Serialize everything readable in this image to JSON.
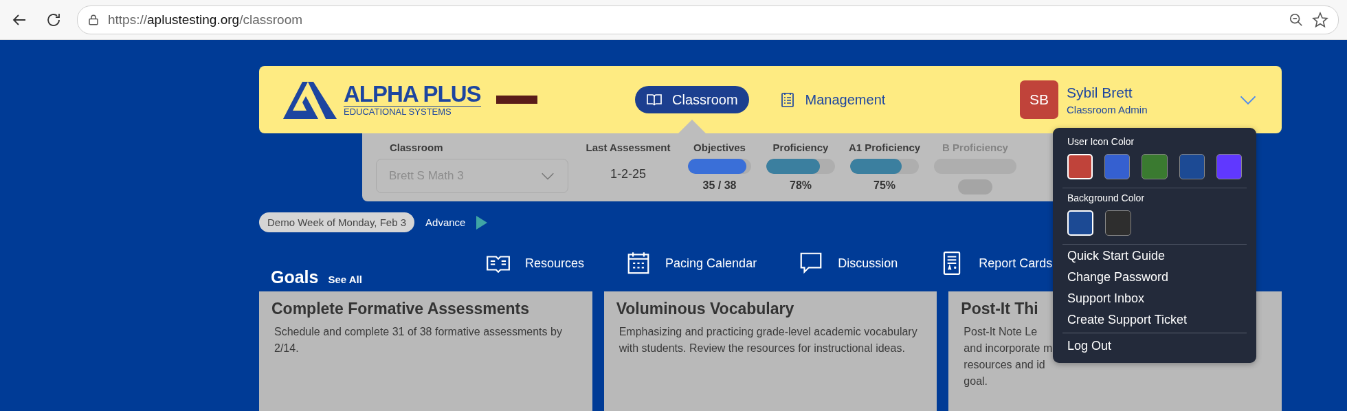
{
  "browser": {
    "url_scheme": "https://",
    "url_host": "aplustesting.org",
    "url_path": "/classroom"
  },
  "header": {
    "logo": {
      "title": "ALPHA PLUS",
      "subtitle": "EDUCATIONAL SYSTEMS"
    },
    "tabs": [
      {
        "label": "Classroom",
        "selected": true
      },
      {
        "label": "Management",
        "selected": false
      }
    ],
    "user": {
      "initials": "SB",
      "name": "Sybil Brett",
      "role": "Classroom Admin",
      "menu_expanded": true
    }
  },
  "stats": {
    "classroom": {
      "label": "Classroom",
      "value": "Brett S Math 3"
    },
    "last_assessment": {
      "label": "Last Assessment",
      "value": "1-2-25"
    },
    "metrics": [
      {
        "label": "Objectives",
        "level": 0.92,
        "reading": "35 / 38",
        "color": "#3a6fd8",
        "disabled": false
      },
      {
        "label": "Proficiency",
        "level": 0.78,
        "reading": "78%",
        "color": "#3b7f9f",
        "disabled": false
      },
      {
        "label": "A1 Proficiency",
        "level": 0.75,
        "reading": "75%",
        "color": "#3b7f9f",
        "disabled": false
      },
      {
        "label": "B Proficiency",
        "disabled": true
      }
    ]
  },
  "demo": {
    "week": "Demo Week of Monday, Feb 3",
    "advance": "Advance"
  },
  "goals": {
    "title": "Goals",
    "see_all": "See All"
  },
  "links": [
    {
      "label": "Resources",
      "kind": "book"
    },
    {
      "label": "Pacing Calendar",
      "kind": "calendar"
    },
    {
      "label": "Discussion",
      "kind": "chat"
    },
    {
      "label": "Report Cards",
      "kind": "report"
    }
  ],
  "cards": [
    {
      "title": "Complete Formative Assessments",
      "text": "Schedule and complete 31 of 38 formative assessments by 2/14."
    },
    {
      "title": "Voluminous Vocabulary",
      "text": "Emphasizing and practicing grade-level academic vocabulary with students. Review the resources for instructional ideas."
    },
    {
      "title": "Post-It Thi",
      "lines": [
        "Post-It Note Le",
        "and incorporate m",
        "resources and id",
        "goal."
      ]
    }
  ],
  "user_menu": {
    "icon_color_label": "User Icon Color",
    "icon_colors": [
      {
        "color": "#c0433a",
        "selected": true
      },
      {
        "color": "#3560d0",
        "selected": false
      },
      {
        "color": "#3a7a30",
        "selected": false
      },
      {
        "color": "#1c4a94",
        "selected": false
      },
      {
        "color": "#6038ff",
        "selected": false
      }
    ],
    "background_color_label": "Background Color",
    "background_colors": [
      {
        "color": "#1c4a94",
        "selected": true
      },
      {
        "color": "#2e2e2e",
        "selected": false
      }
    ],
    "items": [
      {
        "label": "Quick Start Guide"
      },
      {
        "label": "Change Password"
      },
      {
        "label": "Support Inbox"
      },
      {
        "label": "Create Support Ticket"
      },
      {
        "label": "Log Out",
        "separated": true
      }
    ]
  }
}
